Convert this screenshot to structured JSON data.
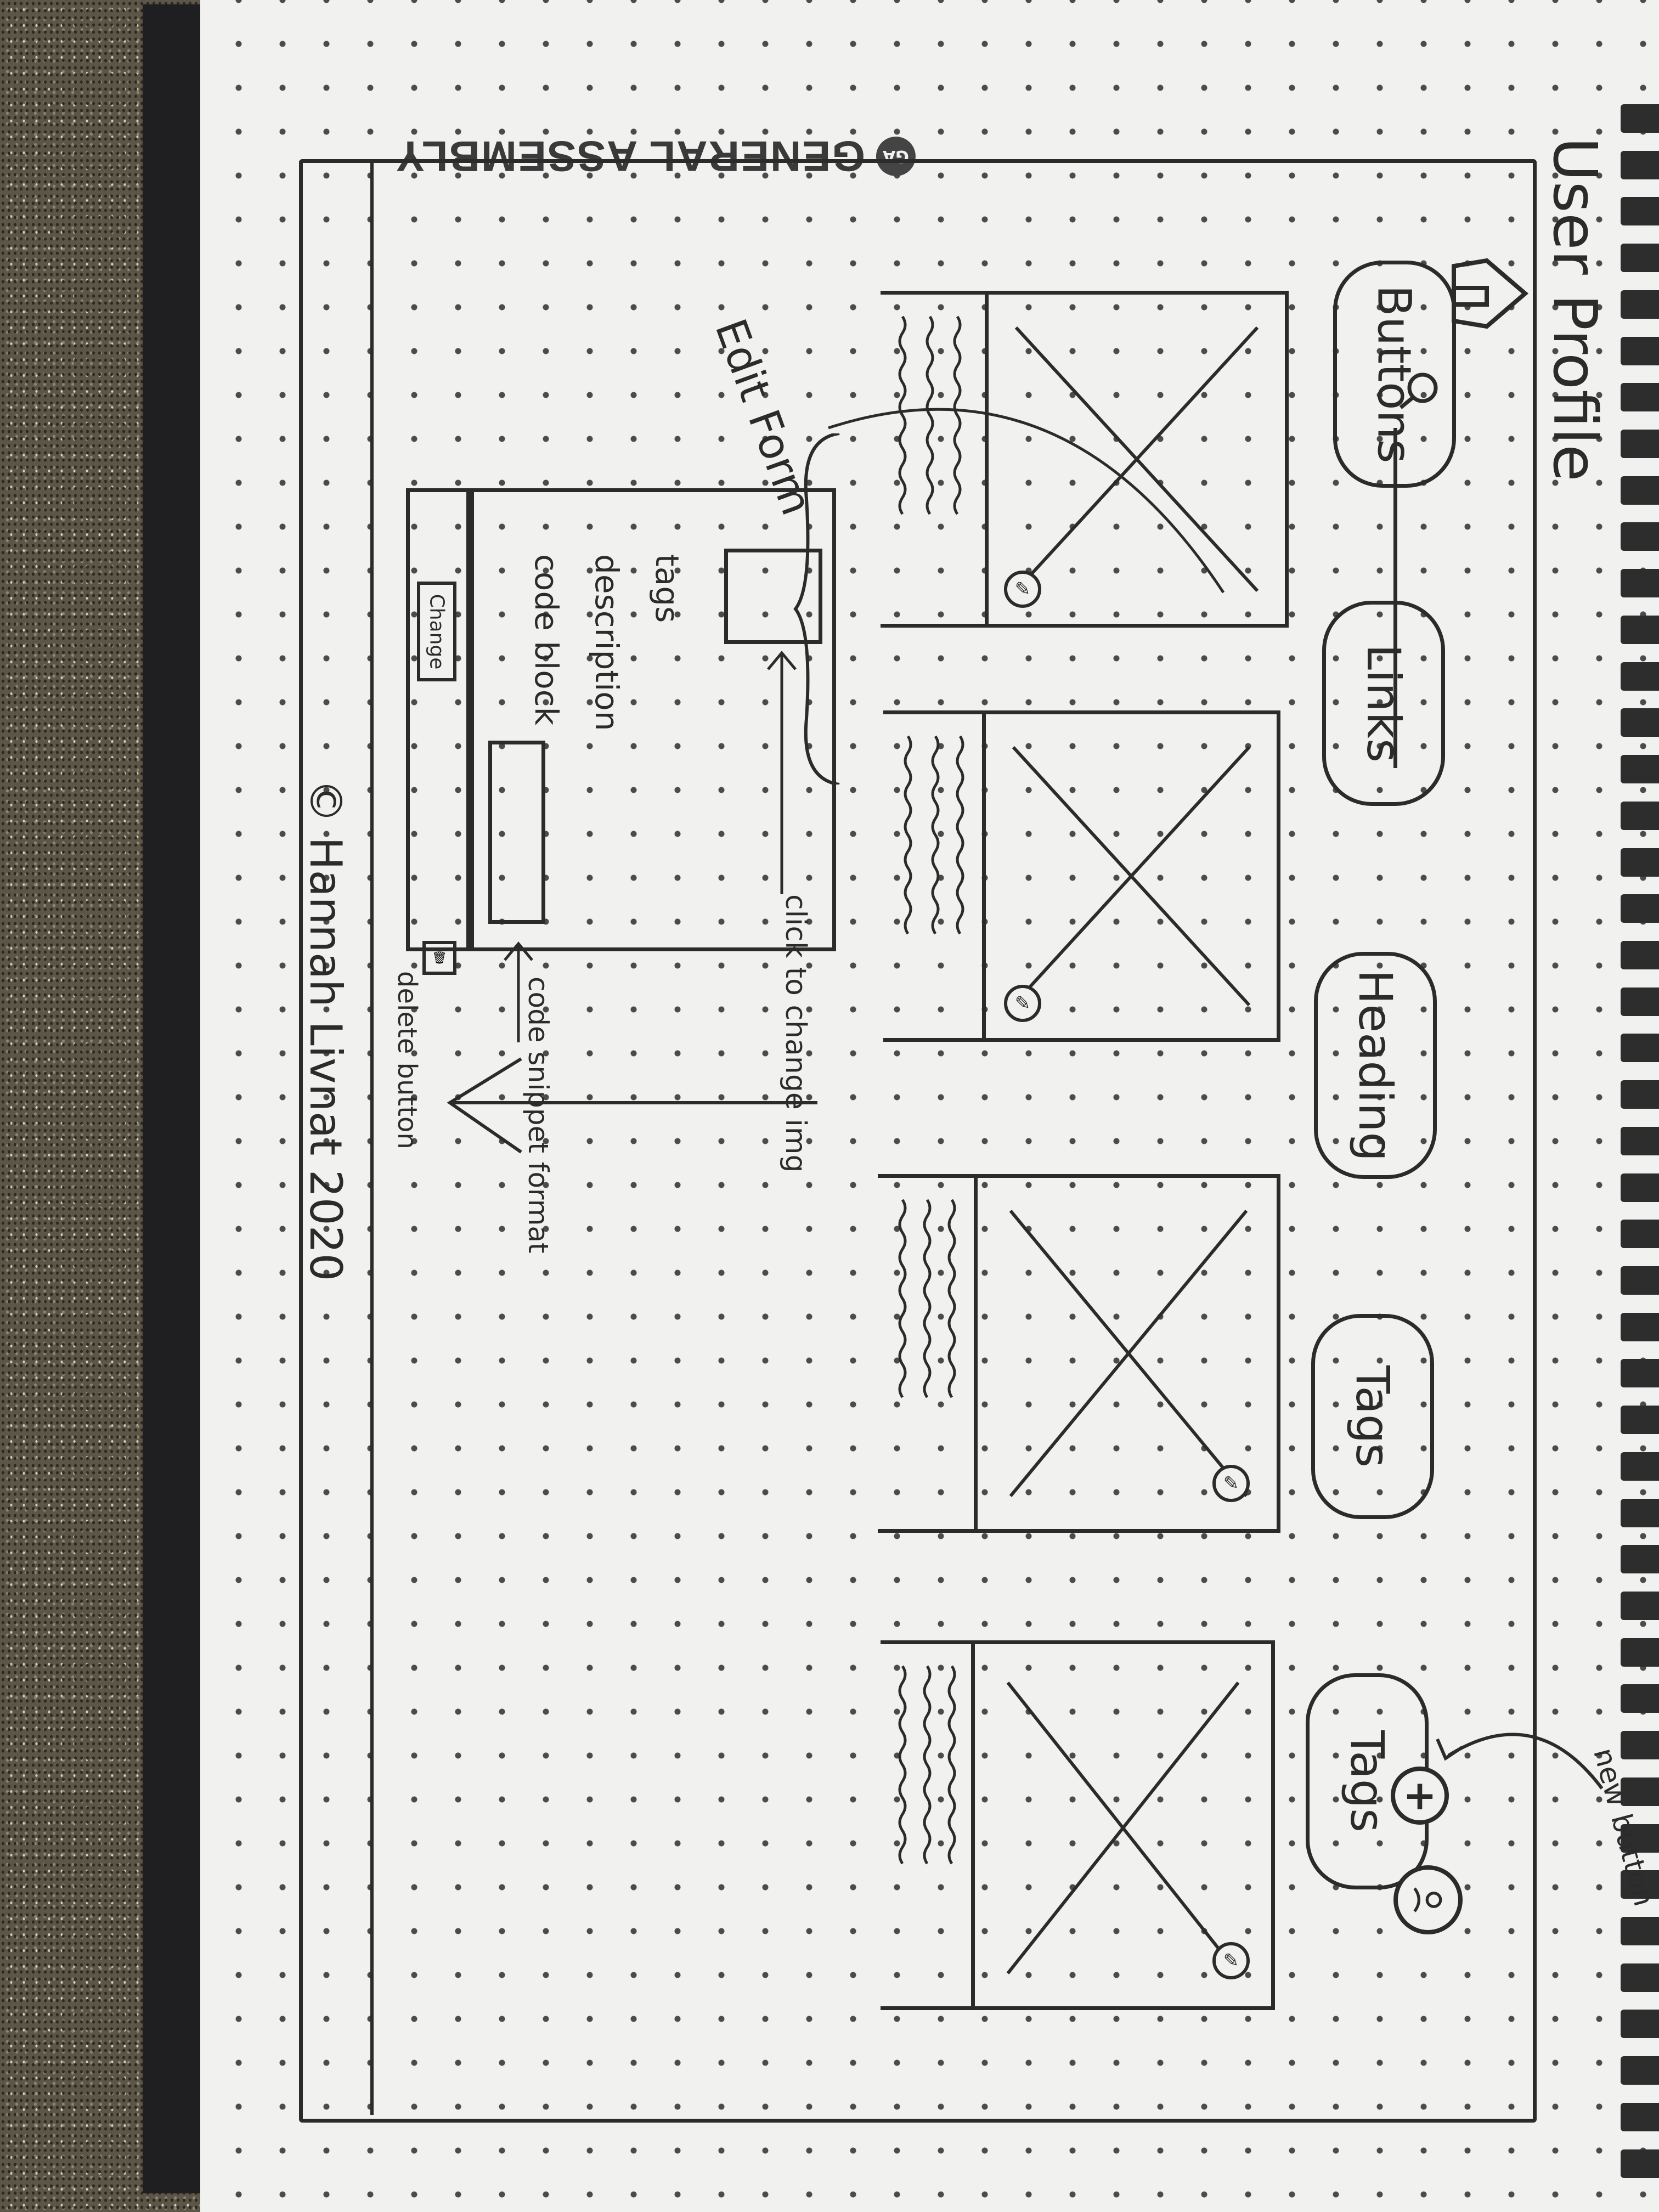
{
  "page_title": "User Profile",
  "logo": {
    "text": "GENERAL ASSEMBLY",
    "badge": "GA"
  },
  "nav": {
    "home_icon": "house-icon",
    "search_icon": "search-icon",
    "add_icon": "plus-icon",
    "profile_icon": "user-avatar-icon"
  },
  "annotations": {
    "new_button": "new button",
    "edit_form": "Edit Form",
    "click_to_change_img": "click to change img",
    "code_snippet_format": "code snippet format",
    "delete_button": "delete button"
  },
  "filter_buttons": [
    {
      "label": "Buttons"
    },
    {
      "label": "Links"
    },
    {
      "label": "Heading"
    },
    {
      "label": "Tags"
    },
    {
      "label": "Tags"
    }
  ],
  "edit_form": {
    "fields": [
      "tags",
      "description",
      "code block"
    ],
    "change_label": "Change"
  },
  "footer": "© Hannah Livnat 2020",
  "colors": {
    "ink": "#2b2b2b",
    "paper": "#f1f1ef"
  }
}
